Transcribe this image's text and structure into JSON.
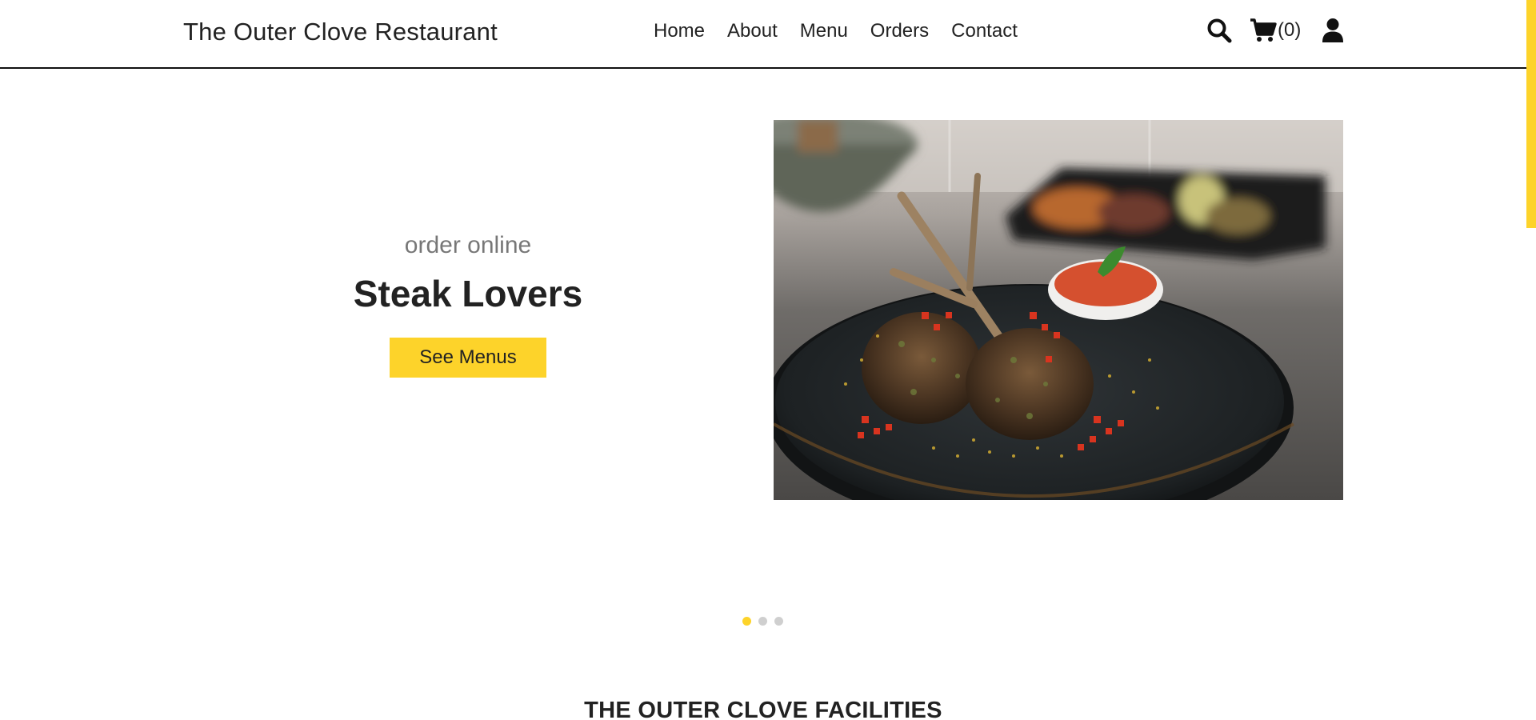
{
  "header": {
    "brand": "The Outer Clove Restaurant",
    "nav": [
      "Home",
      "About",
      "Menu",
      "Orders",
      "Contact"
    ],
    "cart_count": "(0)",
    "icons": {
      "search": "search-icon",
      "cart": "cart-icon",
      "user": "user-icon"
    }
  },
  "hero": {
    "subtitle": "order online",
    "title": "Steak Lovers",
    "button": "See Menus",
    "image": "grilled lamb chops on a dark plate with red salsa and herb crumb"
  },
  "carousel": {
    "slides": 3,
    "active_index": 0
  },
  "sections": {
    "facilities_title": "THE OUTER CLOVE FACILITIES"
  },
  "colors": {
    "accent": "#fdd32a",
    "text": "#222222",
    "muted": "#777777",
    "dot_inactive": "#cfcfcf"
  }
}
